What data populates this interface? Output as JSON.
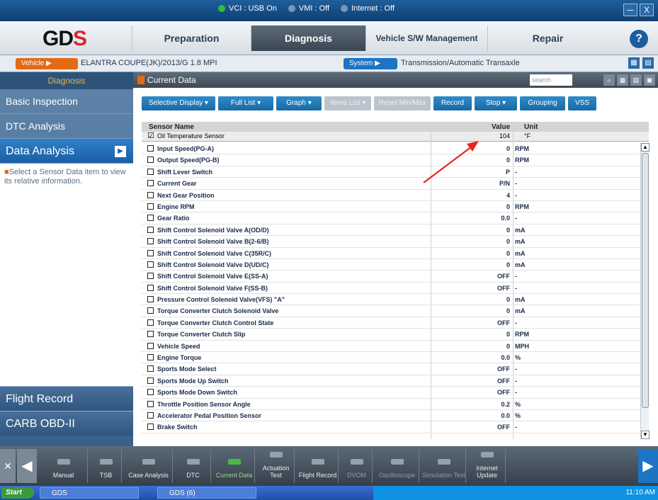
{
  "titlebar": {
    "status": [
      {
        "label": "VCI : USB On",
        "color": "#32c132"
      },
      {
        "label": "VMI : Off",
        "color": "#7a96b4"
      },
      {
        "label": "Internet : Off",
        "color": "#7a96b4"
      }
    ],
    "buttons": [
      "─",
      "X"
    ]
  },
  "nav": {
    "logo_left": "G",
    "logo_mid": "D",
    "logo_right": "S",
    "tabs": [
      "Preparation",
      "Diagnosis",
      "Vehicle S/W Management",
      "Repair"
    ],
    "help": "?"
  },
  "vehicle": {
    "vehicle_btn": "Vehicle ▶",
    "vehicle_text": "ELANTRA COUPE(JK)/2013/G 1.8 MPI",
    "system_btn": "System ▶",
    "system_text": "Transmission/Automatic Transaxle"
  },
  "sidebar": {
    "header": "Diagnosis",
    "items": [
      "Basic Inspection",
      "DTC Analysis",
      "Data Analysis"
    ],
    "info": "Select a Sensor Data item to view its relative information.",
    "bottom": [
      "Flight Record",
      "CARB OBD-II"
    ]
  },
  "content": {
    "title": "Current Data",
    "search_placeholder": "search",
    "toolbar": [
      "Selective Display ▾",
      "Full List ▾",
      "Graph ▾",
      "Items List ▾",
      "Reset Min/Max",
      "Record",
      "Stop ▾",
      "Grouping",
      "VSS"
    ],
    "toolbar_disabled": [
      false,
      false,
      false,
      true,
      true,
      false,
      false,
      false,
      false
    ],
    "columns": {
      "name": "Sensor Name",
      "value": "Value",
      "unit": "Unit"
    },
    "fixed": {
      "name": "Oil Temperature Sensor",
      "value": "104",
      "unit": "°F",
      "checked": "☑"
    },
    "rows": [
      {
        "name": "Input Speed(PG-A)",
        "value": "0",
        "unit": "RPM"
      },
      {
        "name": "Output Speed(PG-B)",
        "value": "0",
        "unit": "RPM"
      },
      {
        "name": "Shift Lever Switch",
        "value": "P",
        "unit": "-"
      },
      {
        "name": "Current Gear",
        "value": "P/N",
        "unit": "-"
      },
      {
        "name": "Next Gear Position",
        "value": "4",
        "unit": "-"
      },
      {
        "name": "Engine RPM",
        "value": "0",
        "unit": "RPM"
      },
      {
        "name": "Gear Ratio",
        "value": "0.0",
        "unit": "-"
      },
      {
        "name": "Shift Control Solenoid Valve A(OD/D)",
        "value": "0",
        "unit": "mA"
      },
      {
        "name": "Shift Control Solenoid Valve B(2-6/B)",
        "value": "0",
        "unit": "mA"
      },
      {
        "name": "Shift Control Solenoid Valve C(35R/C)",
        "value": "0",
        "unit": "mA"
      },
      {
        "name": "Shift Control Solenoid Valve D(UD/C)",
        "value": "0",
        "unit": "mA"
      },
      {
        "name": "Shift Control Solenoid Valve E(SS-A)",
        "value": "OFF",
        "unit": "-"
      },
      {
        "name": "Shift Control Solenoid Valve F(SS-B)",
        "value": "OFF",
        "unit": "-"
      },
      {
        "name": "Pressure Control Solenoid Valve(VFS) \"A\"",
        "value": "0",
        "unit": "mA"
      },
      {
        "name": "Torque Converter Clutch Solenoid Valve",
        "value": "0",
        "unit": "mA"
      },
      {
        "name": "Torque Converter Clutch Control State",
        "value": "OFF",
        "unit": "-"
      },
      {
        "name": "Torque Converter Clutch Slip",
        "value": "0",
        "unit": "RPM"
      },
      {
        "name": "Vehicle Speed",
        "value": "0",
        "unit": "MPH"
      },
      {
        "name": "Engine Torque",
        "value": "0.0",
        "unit": "%"
      },
      {
        "name": "Sports Mode Select",
        "value": "OFF",
        "unit": "-"
      },
      {
        "name": "Sports Mode Up Switch",
        "value": "OFF",
        "unit": "-"
      },
      {
        "name": "Sports Mode Down Switch",
        "value": "OFF",
        "unit": "-"
      },
      {
        "name": "Throttle Position Sensor Angle",
        "value": "0.2",
        "unit": "%"
      },
      {
        "name": "Accelerator Pedal Position Sensor",
        "value": "0.0",
        "unit": "%"
      },
      {
        "name": "Brake Switch",
        "value": "OFF",
        "unit": "-"
      }
    ]
  },
  "bottombar": {
    "left": "✕",
    "items": [
      "Manual",
      "TSB",
      "Case Analysis",
      "DTC",
      "Current Data",
      "Actuation Test",
      "Flight Record",
      "DVOM",
      "Oscilloscope",
      "Simulation Test",
      "Internet Update"
    ],
    "active_index": 4,
    "dim": [
      false,
      false,
      false,
      false,
      false,
      false,
      false,
      true,
      true,
      true,
      false
    ],
    "next": "▶"
  },
  "taskbar": {
    "start": "Start",
    "tasks": [
      "GDS",
      "GDS (6)"
    ],
    "clock": "11:10 AM"
  }
}
